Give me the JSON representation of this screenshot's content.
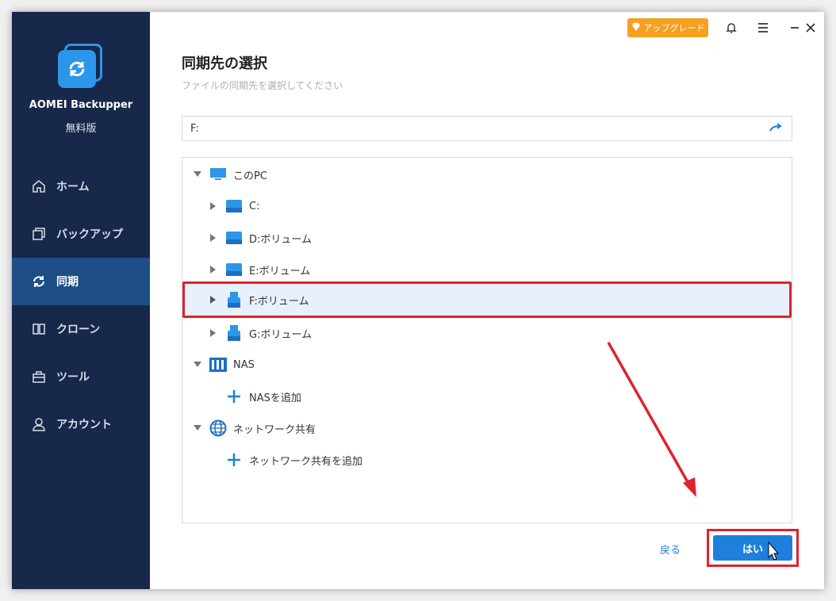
{
  "app": {
    "name": "AOMEI Backupper",
    "edition": "無料版"
  },
  "sidebar": {
    "items": [
      {
        "label": "ホーム",
        "icon": "home-icon",
        "active": false
      },
      {
        "label": "バックアップ",
        "icon": "backup-icon",
        "active": false
      },
      {
        "label": "同期",
        "icon": "sync-icon",
        "active": true
      },
      {
        "label": "クローン",
        "icon": "clone-icon",
        "active": false
      },
      {
        "label": "ツール",
        "icon": "tools-icon",
        "active": false
      },
      {
        "label": "アカウント",
        "icon": "account-icon",
        "active": false
      }
    ]
  },
  "topbar": {
    "upgrade_label": "アップグレード"
  },
  "main": {
    "title": "同期先の選択",
    "subtitle": "ファイルの同期先を選択してください",
    "path_value": "F:"
  },
  "tree": {
    "pc_label": "このPC",
    "drives": [
      {
        "label": "C:",
        "type": "hdd",
        "selected": false
      },
      {
        "label": "D:ボリューム",
        "type": "hdd",
        "selected": false
      },
      {
        "label": "E:ボリューム",
        "type": "hdd",
        "selected": false
      },
      {
        "label": "F:ボリューム",
        "type": "usb",
        "selected": true
      },
      {
        "label": "G:ボリューム",
        "type": "usb",
        "selected": false
      }
    ],
    "nas_label": "NAS",
    "nas_add_label": "NASを追加",
    "network_label": "ネットワーク共有",
    "network_add_label": "ネットワーク共有を追加"
  },
  "footer": {
    "back_label": "戻る",
    "yes_label": "はい"
  },
  "colors": {
    "sidebar_bg": "#17284a",
    "active_bg": "#1d4e86",
    "accent": "#1e7fdc",
    "upgrade": "#f5a021",
    "highlight_red": "#e0222e"
  }
}
